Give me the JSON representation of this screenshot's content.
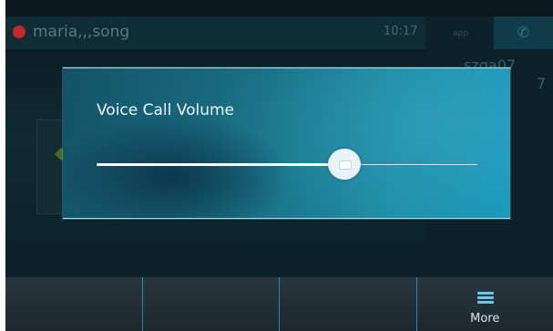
{
  "header": {
    "user_name": "maria,,,song",
    "time": "10:17",
    "small_tag": "app"
  },
  "lines": [
    {
      "name": "szqa07",
      "ext": "7"
    }
  ],
  "dialog": {
    "title": "Voice Call Volume",
    "volume_level": 0.65
  },
  "softkeys": [
    {
      "label": ""
    },
    {
      "label": ""
    },
    {
      "label": ""
    },
    {
      "label": "More",
      "icon": "list-icon"
    }
  ],
  "colors": {
    "accent": "#1f8fa8",
    "status_busy": "#c62828",
    "softkey_divider": "#2a8da5"
  }
}
